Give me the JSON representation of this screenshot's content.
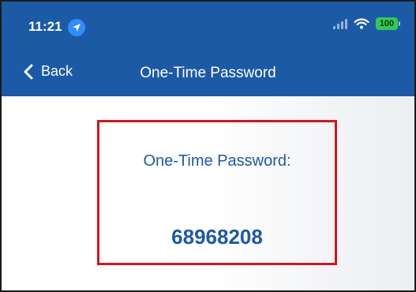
{
  "status_bar": {
    "time": "11:21",
    "battery_level": "100",
    "icons": [
      "location-icon",
      "signal-icon",
      "wifi-icon",
      "battery-icon"
    ]
  },
  "nav": {
    "back_label": "Back",
    "title": "One-Time Password"
  },
  "otp": {
    "label": "One-Time Password:",
    "value": "68968208"
  },
  "colors": {
    "header": "#1c5aa6",
    "otp_text": "#1c5aa6",
    "highlight_border": "#d3151d",
    "battery": "#34c759"
  }
}
